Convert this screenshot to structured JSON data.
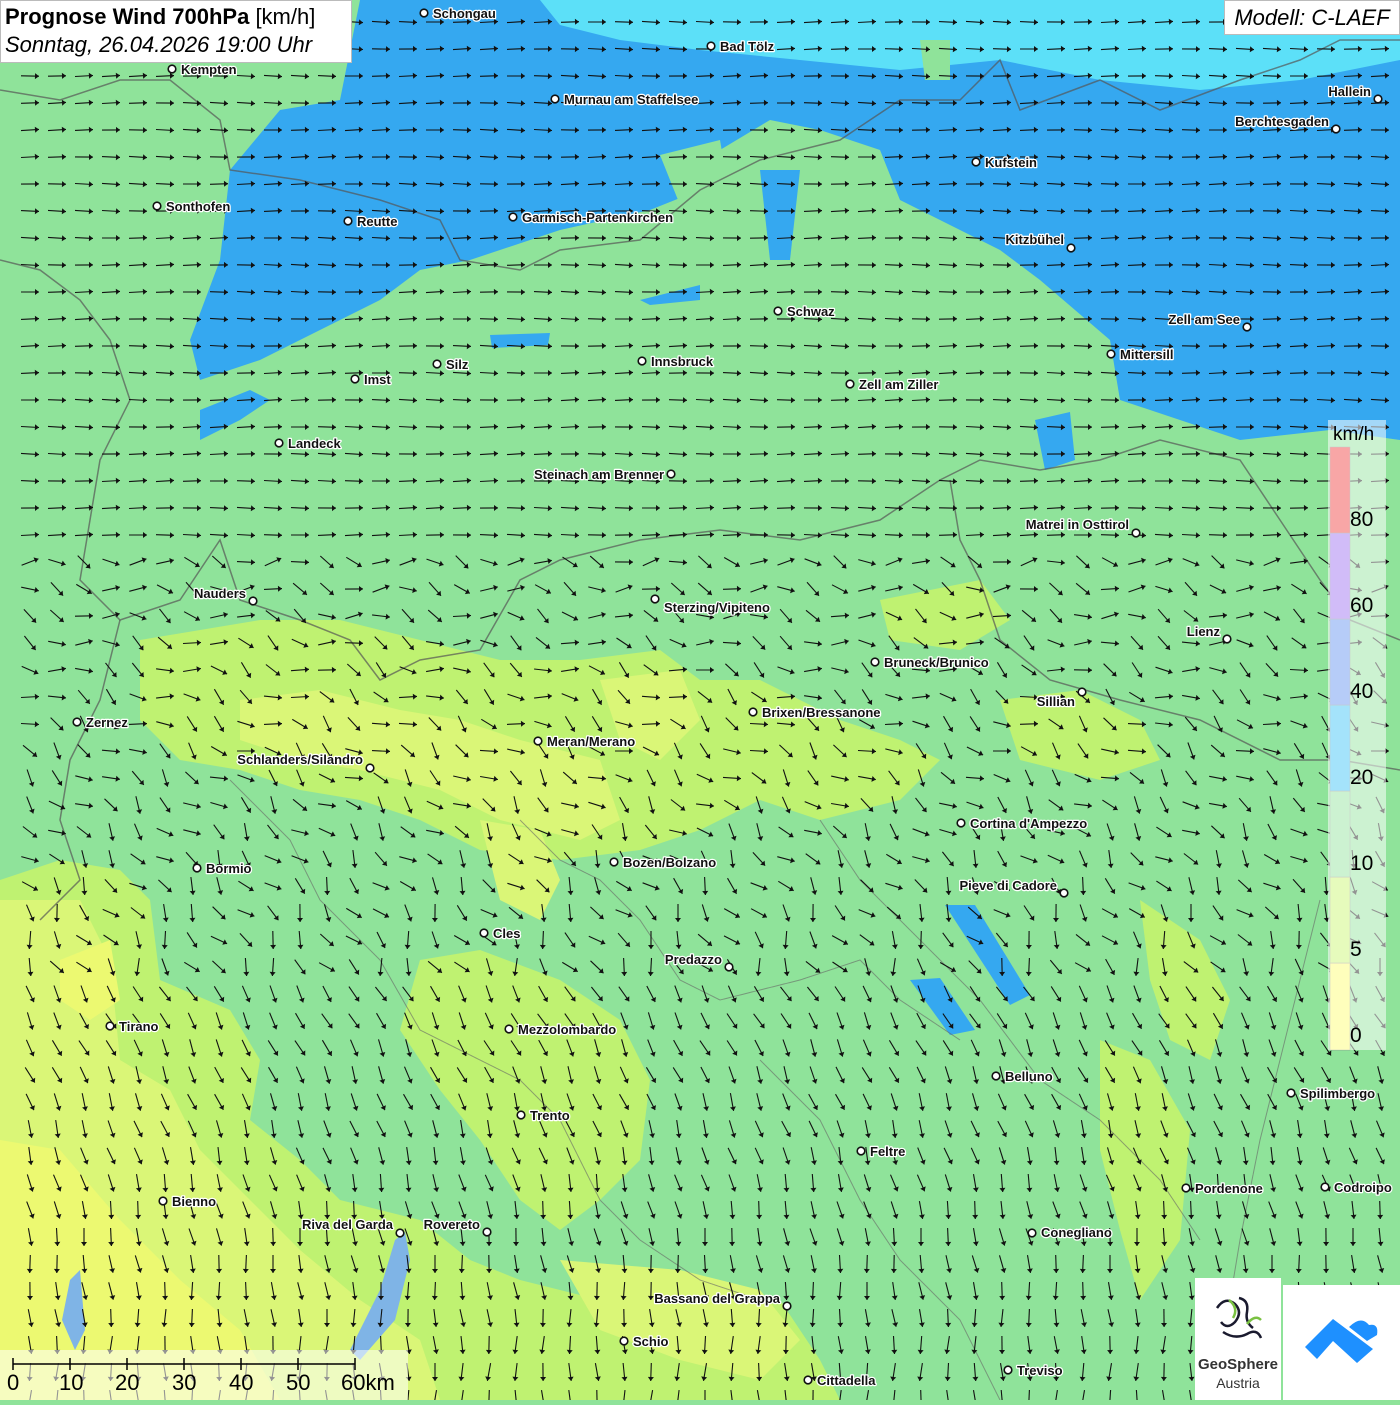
{
  "header": {
    "title_bold": "Prognose Wind 700hPa",
    "title_unit": "[km/h]",
    "subtitle": "Sonntag, 26.04.2026 19:00 Uhr",
    "model": "Modell: C-LAEF"
  },
  "legend": {
    "unit": "km/h",
    "labels": [
      "0",
      "5",
      "10",
      "20",
      "40",
      "60",
      "80"
    ],
    "colors": [
      "#fdfd6b",
      "#c8f56a",
      "#8fe39a",
      "#35c1f5",
      "#5d8ef0",
      "#9a6cf0",
      "#f03a3a"
    ]
  },
  "scale_bar": {
    "labels": [
      "0",
      "10",
      "20",
      "30",
      "40",
      "50",
      "60km"
    ]
  },
  "logo": {
    "text_line1": "GeoSphere",
    "text_line2": "Austria"
  },
  "colors": {
    "calm_yellow": "#fdfd6b",
    "light_green": "#c8f56a",
    "green": "#8fe39a",
    "blue": "#35a8f0",
    "cyan": "#5ce0f8"
  },
  "cities": [
    {
      "name": "Schongau"
    },
    {
      "name": "Bad Tölz"
    },
    {
      "name": "Kempten"
    },
    {
      "name": "Murnau am Staffelsee"
    },
    {
      "name": "Hallein"
    },
    {
      "name": "Berchtesgaden"
    },
    {
      "name": "Kufstein"
    },
    {
      "name": "Sonthofen"
    },
    {
      "name": "Reutte"
    },
    {
      "name": "Garmisch-Partenkirchen"
    },
    {
      "name": "Kitzbühel"
    },
    {
      "name": "Schwaz"
    },
    {
      "name": "Zell am See"
    },
    {
      "name": "Mittersill"
    },
    {
      "name": "Silz"
    },
    {
      "name": "Innsbruck"
    },
    {
      "name": "Imst"
    },
    {
      "name": "Zell am Ziller"
    },
    {
      "name": "Landeck"
    },
    {
      "name": "Steinach am Brenner"
    },
    {
      "name": "Matrei in Osttirol"
    },
    {
      "name": "Nauders"
    },
    {
      "name": "Sterzing/Vipiteno"
    },
    {
      "name": "Lienz"
    },
    {
      "name": "Bruneck/Brunico"
    },
    {
      "name": "Sillian"
    },
    {
      "name": "Brixen/Bressanone"
    },
    {
      "name": "Zernez"
    },
    {
      "name": "Meran/Merano"
    },
    {
      "name": "Schlanders/Silandro"
    },
    {
      "name": "Cortina d'Ampezzo"
    },
    {
      "name": "Bozen/Bolzano"
    },
    {
      "name": "Bormio"
    },
    {
      "name": "Pieve di Cadore"
    },
    {
      "name": "Cles"
    },
    {
      "name": "Predazzo"
    },
    {
      "name": "Tirano"
    },
    {
      "name": "Mezzolombardo"
    },
    {
      "name": "Belluno"
    },
    {
      "name": "Spilimbergo"
    },
    {
      "name": "Trento"
    },
    {
      "name": "Feltre"
    },
    {
      "name": "Pordenone"
    },
    {
      "name": "Codroipo"
    },
    {
      "name": "Bienno"
    },
    {
      "name": "Riva del Garda"
    },
    {
      "name": "Rovereto"
    },
    {
      "name": "Conegliano"
    },
    {
      "name": "Bassano del Grappa"
    },
    {
      "name": "Schio"
    },
    {
      "name": "Treviso"
    },
    {
      "name": "Cittadella"
    }
  ]
}
